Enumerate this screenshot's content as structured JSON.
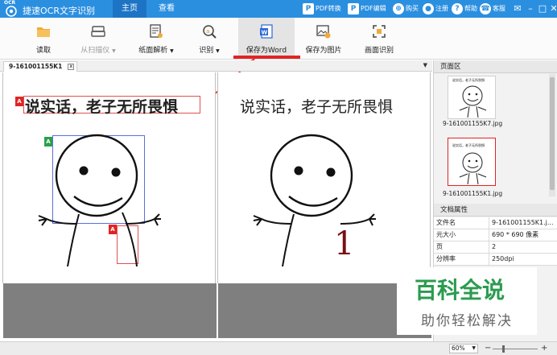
{
  "app": {
    "logo_text": "OCR",
    "title": "捷速OCR文字识别",
    "nav_tabs": [
      {
        "label": "主页",
        "active": true
      },
      {
        "label": "查看",
        "active": false
      }
    ],
    "top_links": {
      "pdf_convert": "PDF转换",
      "pdf_edit": "PDF编辑",
      "buy": "购买",
      "register": "注册",
      "help": "帮助",
      "service": "客服"
    },
    "window_buttons": {
      "skin": "✉",
      "minimize": "–",
      "maximize": "□",
      "close": "✕"
    }
  },
  "toolbar": {
    "items": [
      {
        "label": "读取",
        "icon": "folder-icon",
        "disabled": false,
        "dropdown": false
      },
      {
        "label": "从扫描仪",
        "icon": "scanner-icon",
        "disabled": true,
        "dropdown": true
      },
      {
        "label": "纸面解析",
        "icon": "parse-page-icon",
        "disabled": false,
        "dropdown": true
      },
      {
        "label": "识别",
        "icon": "recognize-icon",
        "disabled": false,
        "dropdown": true
      },
      {
        "label": "保存为Word",
        "icon": "word-icon",
        "disabled": false,
        "dropdown": false,
        "active": true
      },
      {
        "label": "保存为图片",
        "icon": "save-image-icon",
        "disabled": false,
        "dropdown": false
      },
      {
        "label": "画面识别",
        "icon": "screen-capture-icon",
        "disabled": false,
        "dropdown": false
      }
    ],
    "dropdown_glyph": "▼"
  },
  "document": {
    "tab_label": "9-161001155K1",
    "strip_arrow": "▼"
  },
  "left_pane": {
    "text": "说实话，老子无所畏惧",
    "badges": {
      "text_region": "A",
      "image_region": "A",
      "small_region": "A"
    }
  },
  "right_pane": {
    "text": "说实话，老子无所畏惧",
    "number_glyph": "1"
  },
  "page_panel": {
    "title": "页面区",
    "thumbs": [
      {
        "caption": "9-161001155K7.jpg",
        "text": "说实话，老子无所畏惧",
        "selected": false
      },
      {
        "caption": "9-161001155K1.jpg",
        "text": "说实话，老子无所畏惧",
        "selected": true
      }
    ]
  },
  "doc_props": {
    "title": "文档属性",
    "rows": [
      {
        "key": "文件名",
        "value": "9-161001155K1.j..."
      },
      {
        "key": "元大小",
        "value": "690 * 690 像素"
      },
      {
        "key": "页",
        "value": "2"
      },
      {
        "key": "分辨率",
        "value": "250dpi"
      }
    ]
  },
  "watermark": {
    "logo_text": "百科全说",
    "tagline": "助你轻松解决"
  },
  "statusbar": {
    "zoom": "60%",
    "zoom_dropdown": "▼",
    "minus": "−",
    "plus": "+"
  },
  "colors": {
    "titlebar": "#2b8fe0",
    "tab_active": "#1e74c4",
    "accent_red": "#e02424",
    "watermark_green": "#2a9b4f"
  }
}
